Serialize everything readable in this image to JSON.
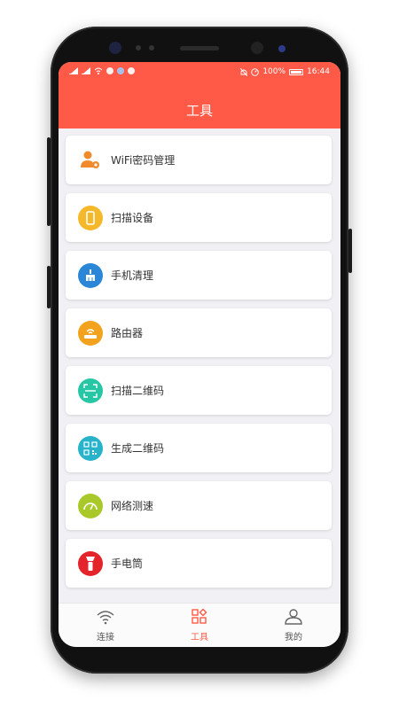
{
  "status": {
    "battery": "100%",
    "time": "16:44"
  },
  "header": {
    "title": "工具"
  },
  "tools": [
    {
      "label": "WiFi密码管理",
      "icon": "user-gear-icon",
      "color": "#f08a2a"
    },
    {
      "label": "扫描设备",
      "icon": "phone-icon",
      "color": "#f5b82a"
    },
    {
      "label": "手机清理",
      "icon": "broom-icon",
      "color": "#2a86d6"
    },
    {
      "label": "路由器",
      "icon": "router-icon",
      "color": "#f3a21d"
    },
    {
      "label": "扫描二维码",
      "icon": "scan-icon",
      "color": "#27c7a6"
    },
    {
      "label": "生成二维码",
      "icon": "qrcode-icon",
      "color": "#27b3c9"
    },
    {
      "label": "网络测速",
      "icon": "speedometer-icon",
      "color": "#a9c92b"
    },
    {
      "label": "手电筒",
      "icon": "flashlight-icon",
      "color": "#e4232a"
    }
  ],
  "tabbar": {
    "tabs": [
      {
        "label": "连接",
        "icon": "wifi-icon"
      },
      {
        "label": "工具",
        "icon": "grid-icon"
      },
      {
        "label": "我的",
        "icon": "user-icon"
      }
    ],
    "active_index": 1,
    "active_color": "#ff5a47"
  }
}
